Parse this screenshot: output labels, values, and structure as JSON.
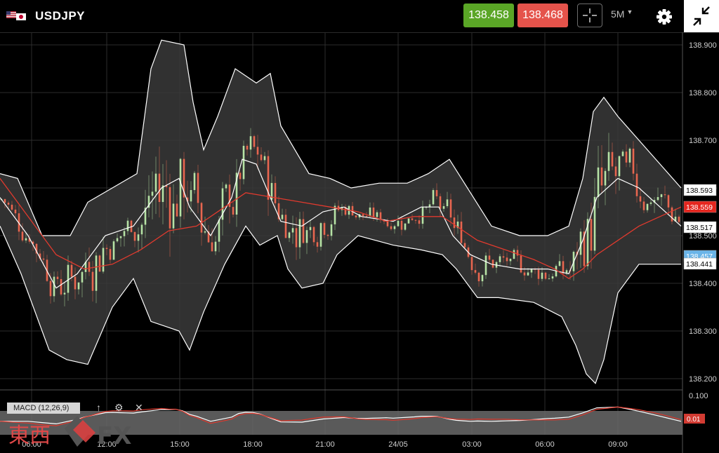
{
  "header": {
    "symbol": "USDJPY",
    "bid": "138.458",
    "ask": "138.468",
    "timeframe": "5M"
  },
  "macd": {
    "label": "MACD (12,26,9)",
    "axis_top": "0.100",
    "value_badge": "0.01"
  },
  "watermark": {
    "kanji": "東西",
    "fx": "FX"
  },
  "colors": {
    "bid": "#5aa626",
    "ask": "#e5534b",
    "up_candle": "#b6e3a5",
    "down_candle": "#e8664f",
    "band_fill": "#3a3a3a",
    "ma_red": "#e03a2e"
  },
  "icons": [
    "flag-us-jp-icon",
    "crosshair-icon",
    "chevron-down-icon",
    "gear-icon",
    "collapse-icon",
    "arrow-up-icon",
    "settings-icon",
    "close-icon"
  ],
  "chart_data": {
    "type": "candlestick",
    "symbol": "USDJPY",
    "timeframe": "5M",
    "ylim": [
      138.18,
      138.93
    ],
    "y_ticks": [
      "138.900",
      "138.800",
      "138.700",
      "138.600",
      "138.500",
      "138.400",
      "138.300",
      "138.200"
    ],
    "x_ticks": [
      "06:00",
      "12:00",
      "15:00",
      "18:00",
      "21:00",
      "24/05",
      "03:00",
      "06:00",
      "09:00"
    ],
    "grid": true,
    "price_tags": [
      {
        "value": "138.593",
        "kind": "upper-band",
        "color": "#ffffff"
      },
      {
        "value": "138.559",
        "kind": "ask",
        "color": "#e5261f"
      },
      {
        "value": "138.517",
        "kind": "middle-band",
        "color": "#ffffff"
      },
      {
        "value": "138.457",
        "kind": "bid",
        "color": "#6ab4e8"
      },
      {
        "value": "138.441",
        "kind": "lower-band",
        "color": "#ffffff"
      }
    ],
    "series": [
      {
        "role": "upper",
        "points": [
          [
            0,
            138.63
          ],
          [
            25,
            138.62
          ],
          [
            60,
            138.5
          ],
          [
            100,
            138.5
          ],
          [
            125,
            138.57
          ],
          [
            160,
            138.6
          ],
          [
            195,
            138.63
          ],
          [
            215,
            138.85
          ],
          [
            230,
            138.91
          ],
          [
            262,
            138.9
          ],
          [
            275,
            138.78
          ],
          [
            290,
            138.68
          ],
          [
            310,
            138.75
          ],
          [
            335,
            138.85
          ],
          [
            365,
            138.82
          ],
          [
            385,
            138.84
          ],
          [
            400,
            138.73
          ],
          [
            420,
            138.68
          ],
          [
            440,
            138.63
          ],
          [
            470,
            138.62
          ],
          [
            500,
            138.6
          ],
          [
            540,
            138.61
          ],
          [
            580,
            138.61
          ],
          [
            610,
            138.63
          ],
          [
            640,
            138.66
          ],
          [
            670,
            138.59
          ],
          [
            700,
            138.52
          ],
          [
            740,
            138.5
          ],
          [
            780,
            138.5
          ],
          [
            810,
            138.52
          ],
          [
            830,
            138.62
          ],
          [
            845,
            138.76
          ],
          [
            860,
            138.79
          ],
          [
            880,
            138.75
          ],
          [
            910,
            138.7
          ],
          [
            940,
            138.65
          ],
          [
            970,
            138.6
          ]
        ]
      },
      {
        "role": "middle",
        "points": [
          [
            0,
            138.58
          ],
          [
            40,
            138.5
          ],
          [
            80,
            138.39
          ],
          [
            110,
            138.42
          ],
          [
            150,
            138.5
          ],
          [
            190,
            138.52
          ],
          [
            230,
            138.6
          ],
          [
            255,
            138.62
          ],
          [
            270,
            138.56
          ],
          [
            300,
            138.5
          ],
          [
            330,
            138.58
          ],
          [
            345,
            138.66
          ],
          [
            365,
            138.65
          ],
          [
            385,
            138.58
          ],
          [
            400,
            138.53
          ],
          [
            430,
            138.52
          ],
          [
            460,
            138.55
          ],
          [
            490,
            138.56
          ],
          [
            515,
            138.54
          ],
          [
            560,
            138.53
          ],
          [
            600,
            138.56
          ],
          [
            625,
            138.56
          ],
          [
            645,
            138.5
          ],
          [
            670,
            138.46
          ],
          [
            700,
            138.44
          ],
          [
            740,
            138.43
          ],
          [
            780,
            138.43
          ],
          [
            810,
            138.42
          ],
          [
            830,
            138.49
          ],
          [
            850,
            138.58
          ],
          [
            880,
            138.62
          ],
          [
            910,
            138.6
          ],
          [
            940,
            138.56
          ],
          [
            970,
            138.52
          ]
        ]
      },
      {
        "role": "lower",
        "points": [
          [
            0,
            138.52
          ],
          [
            30,
            138.42
          ],
          [
            70,
            138.26
          ],
          [
            95,
            138.24
          ],
          [
            125,
            138.23
          ],
          [
            160,
            138.35
          ],
          [
            190,
            138.41
          ],
          [
            215,
            138.32
          ],
          [
            235,
            138.31
          ],
          [
            255,
            138.3
          ],
          [
            270,
            138.26
          ],
          [
            290,
            138.34
          ],
          [
            320,
            138.44
          ],
          [
            350,
            138.52
          ],
          [
            370,
            138.48
          ],
          [
            395,
            138.5
          ],
          [
            410,
            138.43
          ],
          [
            430,
            138.39
          ],
          [
            460,
            138.4
          ],
          [
            480,
            138.46
          ],
          [
            510,
            138.5
          ],
          [
            560,
            138.48
          ],
          [
            600,
            138.47
          ],
          [
            630,
            138.46
          ],
          [
            650,
            138.43
          ],
          [
            680,
            138.37
          ],
          [
            710,
            138.37
          ],
          [
            760,
            138.36
          ],
          [
            800,
            138.33
          ],
          [
            820,
            138.27
          ],
          [
            835,
            138.21
          ],
          [
            848,
            138.19
          ],
          [
            860,
            138.24
          ],
          [
            880,
            138.38
          ],
          [
            910,
            138.44
          ],
          [
            940,
            138.44
          ],
          [
            970,
            138.44
          ]
        ]
      },
      {
        "role": "ma",
        "points": [
          [
            0,
            138.62
          ],
          [
            40,
            138.54
          ],
          [
            80,
            138.46
          ],
          [
            120,
            138.43
          ],
          [
            160,
            138.44
          ],
          [
            200,
            138.47
          ],
          [
            240,
            138.51
          ],
          [
            280,
            138.52
          ],
          [
            320,
            138.56
          ],
          [
            350,
            138.59
          ],
          [
            390,
            138.58
          ],
          [
            430,
            138.57
          ],
          [
            470,
            138.56
          ],
          [
            510,
            138.55
          ],
          [
            550,
            138.53
          ],
          [
            590,
            138.54
          ],
          [
            630,
            138.54
          ],
          [
            680,
            138.49
          ],
          [
            720,
            138.47
          ],
          [
            760,
            138.45
          ],
          [
            790,
            138.43
          ],
          [
            810,
            138.41
          ],
          [
            830,
            138.43
          ],
          [
            850,
            138.46
          ],
          [
            880,
            138.49
          ],
          [
            910,
            138.52
          ],
          [
            940,
            138.54
          ],
          [
            970,
            138.56
          ]
        ]
      }
    ]
  }
}
